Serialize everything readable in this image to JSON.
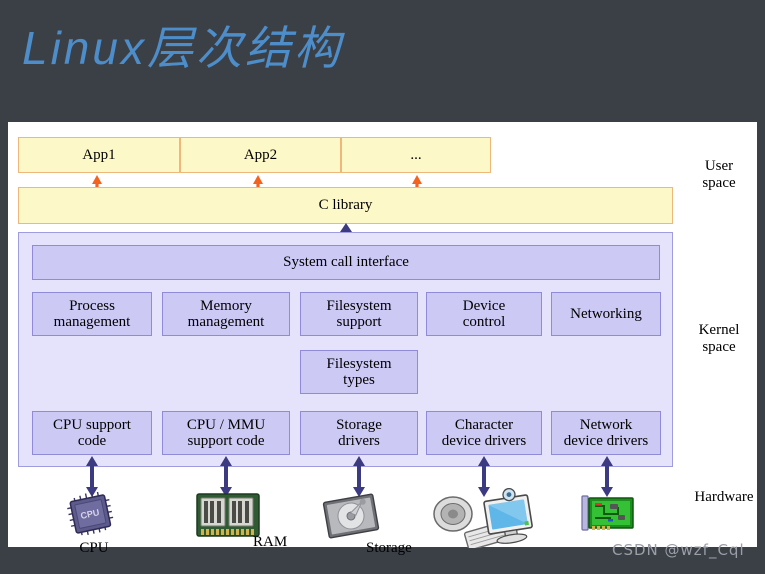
{
  "title": "Linux层次结构",
  "title_color": "#4d8dc9",
  "background_color": "#3b3f46",
  "canvas_color": "#ffffff",
  "colors": {
    "user_fill": "#fdf8c8",
    "user_border": "#f0b77a",
    "kernel_outer_fill": "#e5e3fb",
    "kernel_outer_border": "#9f9ce0",
    "kernel_box_fill": "#ccc9f5",
    "kernel_box_border": "#8f8bd8",
    "user_arrow": "#f4621f",
    "kernel_arrow": "#3c3a80"
  },
  "user_space": {
    "apps": [
      {
        "label": "App1"
      },
      {
        "label": "App2"
      },
      {
        "label": "..."
      }
    ],
    "c_library": "C library",
    "side_label_line1": "User",
    "side_label_line2": "space"
  },
  "kernel_space": {
    "system_call_interface": "System call interface",
    "subsystems": [
      {
        "line1": "Process",
        "line2": "management"
      },
      {
        "line1": "Memory",
        "line2": "management"
      },
      {
        "line1": "Filesystem",
        "line2": "support"
      },
      {
        "line1": "Device",
        "line2": "control"
      },
      {
        "line1": "Networking",
        "line2": ""
      }
    ],
    "filesystem_types": {
      "line1": "Filesystem",
      "line2": "types"
    },
    "drivers": [
      {
        "line1": "CPU support",
        "line2": "code"
      },
      {
        "line1": "CPU / MMU",
        "line2": "support code"
      },
      {
        "line1": "Storage",
        "line2": "drivers"
      },
      {
        "line1": "Character",
        "line2": "device drivers"
      },
      {
        "line1": "Network",
        "line2": "device drivers"
      }
    ],
    "side_label_line1": "Kernel",
    "side_label_line2": "space"
  },
  "hardware": {
    "side_label": "Hardware",
    "devices": [
      {
        "icon": "cpu-chip-icon",
        "label": "CPU"
      },
      {
        "icon": "ram-module-icon",
        "label": "RAM"
      },
      {
        "icon": "hard-disk-icon",
        "label": "Storage"
      },
      {
        "icon": "speaker-keyboard-monitor-icon",
        "label": ""
      },
      {
        "icon": "network-card-icon",
        "label": ""
      }
    ]
  },
  "watermark": "CSDN @wzf_Cql"
}
